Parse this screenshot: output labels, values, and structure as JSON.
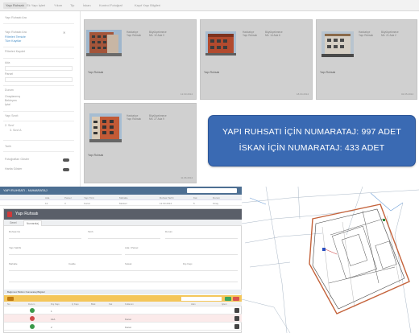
{
  "top": {
    "tabs": [
      "Yapı Ruhsatı",
      "Ek Yapı İşleri",
      "Yıkım",
      "Tip",
      "İskan",
      "Kontrol Fotoğraf",
      "Kayıt Yapı Bilgileri"
    ],
    "filter": {
      "title": "Yapı Ruhsatı Ara",
      "link_a": "Filtreleri Temizle",
      "link_b": "Tüm Kayıtlar",
      "link_c": "Filtreleri Kaydet",
      "label_ada": "Ada",
      "label_parsel": "Parsel",
      "label_durum": "Durum",
      "opt_1": "Onaylanmış",
      "opt_2": "Bekleyen",
      "opt_3": "İptal",
      "label_yapi": "Yapı Sınıfı",
      "tree_1": "2. Sınıf",
      "tree_2": "3. Sınıf A",
      "label_tarih": "Tarih",
      "toggle_1": "Fotoğrafları Göster",
      "toggle_2": "Harita Göster"
    },
    "cards": [
      {
        "meta_l": "Hasbahçe\nYapı Ruhsatı",
        "meta_r": "Büyükçekmece\nMh. 12 Ada 3",
        "title": "Yapı Ruhsatı",
        "footer": "12.03.2014"
      },
      {
        "meta_l": "Hasbahçe\nYapı Ruhsatı",
        "meta_r": "Büyükçekmece\nMh. 14 Ada 6",
        "title": "Yapı Ruhsatı",
        "footer": "18.04.2014"
      },
      {
        "meta_l": "Hasbahçe\nYapı Ruhsatı",
        "meta_r": "Büyükçekmece\nMh. 21 Ada 2",
        "title": "Yapı Ruhsatı",
        "footer": "02.05.2014"
      },
      {
        "meta_l": "Hasbahçe\nYapı Ruhsatı",
        "meta_r": "Büyükçekmece\nMh. 27 Ada 9",
        "title": "Yapı Ruhsatı",
        "footer": "11.06.2014"
      }
    ],
    "banner": {
      "line1": "YAPI RUHSATI İÇİN NUMARATAJ: 997 ADET",
      "line2": "İSKAN İÇİN NUMARATAJ: 433 ADET"
    }
  },
  "bottom_left": {
    "header_title": "YAPI RUHSATI - NUMARATAJ",
    "grid_head": [
      "Ada",
      "Parsel",
      "Yapı Türü",
      "Mahalle",
      "Ruhsat Tarihi",
      "Kat",
      "Durum"
    ],
    "grid_row": [
      "12",
      "3",
      "Konut",
      "Merkez",
      "12.03.2014",
      "5",
      "Onay"
    ],
    "dialog_title": "Yapı Ruhsatı",
    "dialog_tabs": [
      "Genel",
      "Numarataj"
    ],
    "fields": {
      "f1": "Ruhsat No",
      "f2": "Tarih",
      "f3": "Durum",
      "f4": "Yapı Sahibi",
      "f5": "Ada / Parsel",
      "f6": "Mahalle",
      "f7": "Cadde",
      "f8": "Sokak",
      "f9": "Dış Kapı"
    },
    "section_title": "Bağımsız Bölüm Numarataj Bilgileri",
    "sub_head": [
      "No",
      "Durum",
      "Dış Kapı",
      "İç Kapı",
      "Blok",
      "Kat",
      "Kullanım",
      "Alan",
      "İşlem"
    ],
    "sub_rows": [
      {
        "no": "",
        "kapi": "1",
        "ic": "",
        "blok": "",
        "kat": "",
        "kullanim": "",
        "alan": "",
        "durum_color": "#3a9a4a"
      },
      {
        "no": "",
        "kapi": "12A",
        "ic": "",
        "blok": "",
        "kat": "",
        "kullanim": "Konut",
        "alan": "",
        "durum_color": "#d04a4a"
      },
      {
        "no": "",
        "kapi": "2",
        "ic": "",
        "blok": "",
        "kat": "",
        "kullanim": "Konut",
        "alan": "",
        "durum_color": "#3a9a4a"
      },
      {
        "no": "",
        "kapi": "4",
        "ic": "",
        "blok": "",
        "kat": "",
        "kullanim": "Konut",
        "alan": "",
        "durum_color": "#3a9a4a"
      }
    ]
  },
  "colors": {
    "banner": "#3a6ab3",
    "header": "#4d6f92",
    "toolbar": "#f4c65a",
    "dialog_header": "#5a5f69"
  }
}
